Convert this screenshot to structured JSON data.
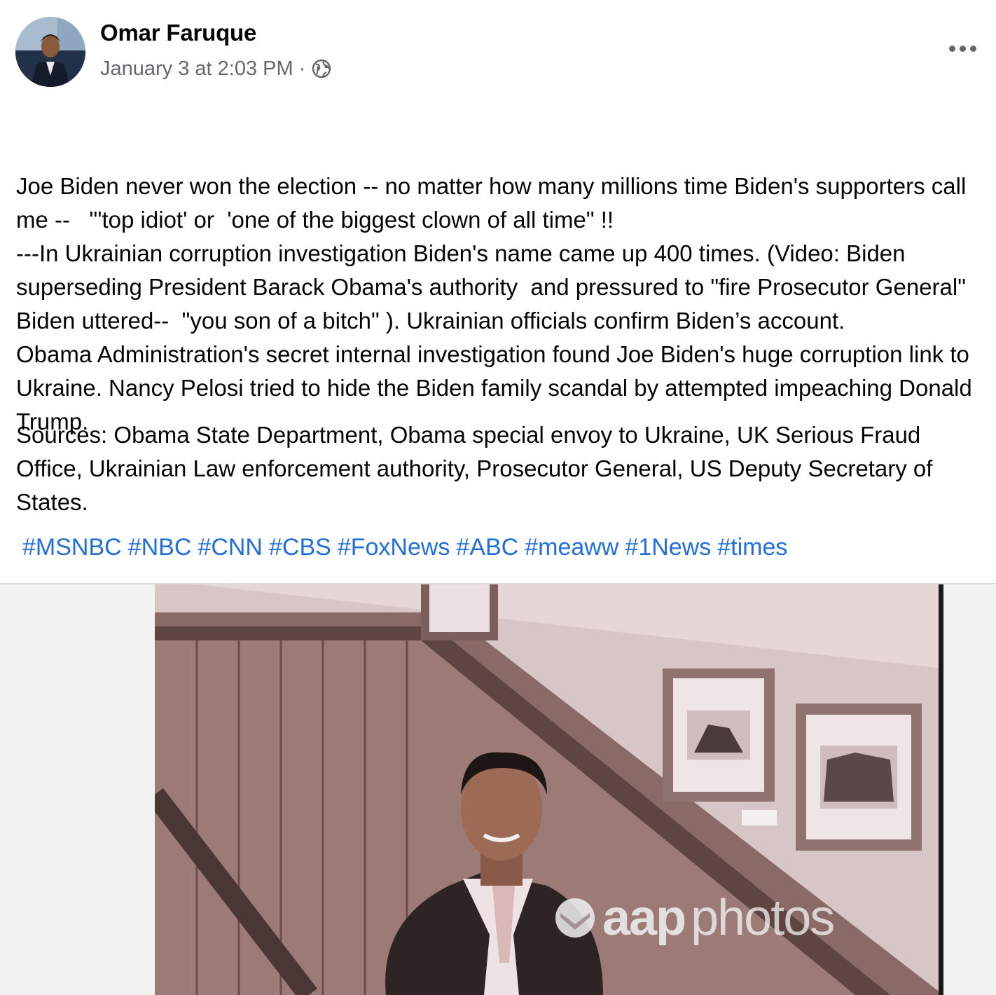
{
  "post": {
    "author": "Omar Faruque",
    "timestamp": "January 3 at 2:03 PM",
    "separator": "·",
    "privacy_icon": "globe-icon",
    "more_icon": "more-options-icon",
    "paragraphs": [
      "Joe Biden never won the election -- no matter how many millions time Biden's supporters call me --   \"'top idiot' or  'one of the biggest clown of all time\" !!\n---In Ukrainian corruption investigation Biden's name came up 400 times. (Video: Biden superseding President Barack Obama's authority  and pressured to \"fire Prosecutor General\" Biden uttered--  \"you son of a bitch\" ). Ukrainian officials confirm Biden’s account.\nObama Administration's secret internal investigation found Joe Biden's huge corruption link to Ukraine. Nancy Pelosi tried to hide the Biden family scandal by attempted impeaching Donald Trump."
    ],
    "sources": "Sources: Obama State Department, Obama special envoy to Ukraine, UK Serious Fraud Office, Ukrainian Law enforcement authority, Prosecutor General, US Deputy Secretary of States.",
    "hashtags": [
      "#MSNBC",
      "#NBC",
      "#CNN",
      "#CBS",
      "#FoxNews",
      "#ABC",
      "#meaww",
      "#1News",
      "#times"
    ],
    "image": {
      "watermark_brand": "aap",
      "watermark_suffix": "photos"
    }
  },
  "colors": {
    "text": "#050505",
    "secondary": "#65676b",
    "link": "#216fdb"
  }
}
